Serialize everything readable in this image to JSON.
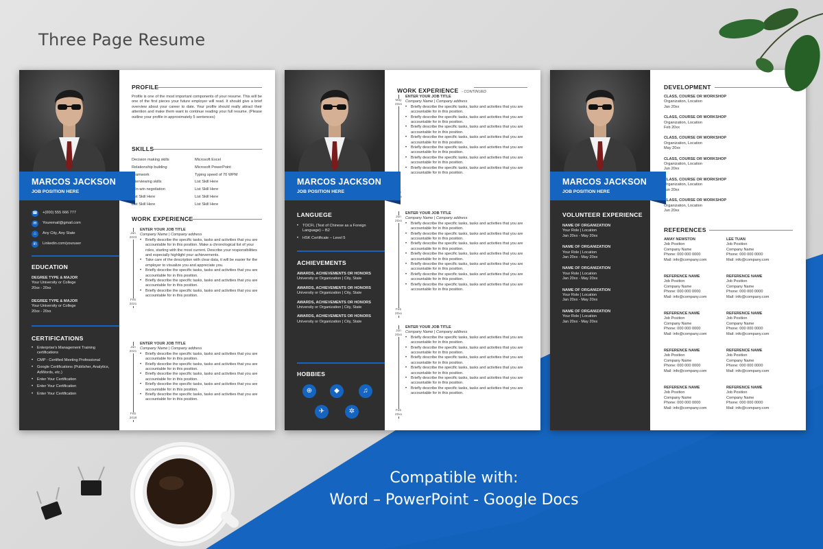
{
  "headline": "Three Page Resume",
  "cta": {
    "line1": "Compatible with:",
    "line2": "Word – PowerPoint - Google Docs"
  },
  "colors": {
    "accent": "#1565c0",
    "sidebar": "#2f2f2f",
    "background": "#dcdcdc"
  },
  "person": {
    "name": "MARCOS JACKSON",
    "job_position": "JOB POSITION HERE"
  },
  "page1": {
    "contacts": [
      {
        "icon": "phone-icon",
        "text": "+(000) 555 666 777"
      },
      {
        "icon": "email-icon",
        "text": "Youremail@gmail.com"
      },
      {
        "icon": "location-icon",
        "text": "Any City, Any State"
      },
      {
        "icon": "linkedin-icon",
        "text": "Linkedin.com/youruser"
      }
    ],
    "education_title": "EDUCATION",
    "education": [
      {
        "degree": "DEGREE TYPE & MAJOR",
        "school": "Your University or College",
        "years": "20xx - 20xx"
      },
      {
        "degree": "DEGREE TYPE & MAJOR",
        "school": "Your University or College",
        "years": "20xx - 20xx"
      }
    ],
    "certifications_title": "CERTIFICATIONS",
    "certifications": [
      "Enterprise's Management Training certifications",
      "CMP - Certified Meeting Professional",
      "Google Certifications (Publisher, Analytics, AdWords, etc.)",
      "Enter Your Certification",
      "Enter Your Certification",
      "Enter Your Certification"
    ],
    "profile_title": "PROFILE",
    "profile_text": "Profile is one of the most important components of your resume. This will be one of the first pieces your future employer will read. It should give a brief overview about your career to date. Your profile should really attract their attention and make them want to continue reading your full resume. (Please outline your profile in approximately 5 sentences)",
    "skills_title": "SKILLS",
    "skills_left": [
      "Decision making skills",
      "Relationship building",
      "Teamwork",
      "Interviewing skills",
      "Win-win negotiation",
      "List Skill Here",
      "List Skill Here"
    ],
    "skills_right": [
      "Microsoft Excel",
      "Microsoft PowerPoint",
      "Typing speed of 70 WPM",
      "List Skill Here",
      "List Skill Here",
      "List Skill Here",
      "List Skill Here"
    ],
    "work_title": "WORK EXPERIENCE",
    "jobs": [
      {
        "title": "ENTER YOUR JOB TITLE",
        "company": "Company Name | Company address",
        "start": "Jan 2023",
        "end": "Feb 2021",
        "bullets": [
          "Briefly describe the specific tasks, tasks and activities that you are accountable for in this position. Make a chronological list of your roles, starting with the most current. Describe your responsibilities and especially highlight your achievements.",
          "Take care of the description with clear data, it will be easier for the employer to visualize you and appreciate you.",
          "Briefly describe the specific tasks, tasks and activities that you are accountable for in this position.",
          "Briefly describe the specific tasks, tasks and activities that you are accountable for in this position.",
          "Briefly describe the specific tasks, tasks and activities that you are accountable for in this position."
        ]
      },
      {
        "title": "ENTER YOUR JOB TITLE",
        "company": "Company Name | Company address",
        "start": "Jan 2021",
        "end": "Feb 2018",
        "bullets": [
          "Briefly describe the specific tasks, tasks and activities that you are accountable for in this position.",
          "Briefly describe the specific tasks, tasks and activities that you are accountable for in this position.",
          "Briefly describe the specific tasks, tasks and activities that you are accountable for in this position.",
          "Briefly describe the specific tasks, tasks and activities that you are accountable for in this position.",
          "Briefly describe the specific tasks, tasks and activities that you are accountable for in this position."
        ]
      }
    ]
  },
  "page2": {
    "language_title": "LANGUEGE",
    "languages": [
      "TOCFL (Test of Chinese as a Foreign Language) – B2",
      "HSK Certificate – Level 5"
    ],
    "achievements_title": "ACHIEVEMENTS",
    "achievements": [
      {
        "title": "AWARDS, ACHIEVEMENTS OR HONORS",
        "org": "University or Organization | City, State"
      },
      {
        "title": "AWARDS, ACHIEVEMENTS OR HONORS",
        "org": "University or Organization | City, State"
      },
      {
        "title": "AWARDS, ACHIEVEMENTS OR HONORS",
        "org": "University or Organization | City, State"
      },
      {
        "title": "AWARDS, ACHIEVEMENTS OR HONORS",
        "org": "University or Organization | City, State"
      }
    ],
    "hobbies_title": "HOBBIES",
    "hobbies": [
      "gamepad-icon",
      "football-icon",
      "music-icon",
      "plane-icon",
      "network-icon"
    ],
    "work_title": "WORK EXPERIENCE",
    "work_subtitle": "- CONTINUED",
    "jobs": [
      {
        "title": "ENTER YOUR JOB TITLE",
        "company": "Company Name | Company address",
        "start": "May 20xx",
        "end": "Mar 20xx"
      },
      {
        "title": "ENTER YOUR JOB TITLE",
        "company": "Company Name | Company address",
        "start": "Jun 20xx",
        "end": "Feb 20xx"
      },
      {
        "title": "ENTER YOUR JOB TITLE",
        "company": "Company Name | Company address",
        "start": "Jun 20xx",
        "end": "Feb 20xx"
      }
    ],
    "bullet_text": "Briefly describe the specific tasks, tasks and activities that you are accountable for in this position."
  },
  "page3": {
    "volunteer_title": "VOLUNTEER EXPERIENCE",
    "volunteer": [
      {
        "org": "NAME OF ORGANIZATION",
        "role": "Your Role | Location",
        "dates": "Jan 20xx - May 20xx"
      },
      {
        "org": "NAME OF ORGANIZATION",
        "role": "Your Role | Location",
        "dates": "Jan 20xx - May 20xx"
      },
      {
        "org": "NAME OF ORGANIZATION",
        "role": "Your Role | Location",
        "dates": "Jan 20xx - May 20xx"
      },
      {
        "org": "NAME OF ORGANIZATION",
        "role": "Your Role | Location",
        "dates": "Jan 20xx - May 20xx"
      },
      {
        "org": "NAME OF ORGANIZATION",
        "role": "Your Role | Location",
        "dates": "Jan 20xx - May 20xx"
      }
    ],
    "development_title": "DEVELOPMENT",
    "development": [
      {
        "title": "CLASS, COURSE OR WORKSHOP",
        "org": "Organization, Location",
        "date": "Jan 20xx"
      },
      {
        "title": "CLASS, COURSE OR WORKSHOP",
        "org": "Organization, Location",
        "date": "Feb 20xx"
      },
      {
        "title": "CLASS, COURSE OR WORKSHOP",
        "org": "Organization, Location",
        "date": "May 20xx"
      },
      {
        "title": "CLASS, COURSE OR WORKSHOP",
        "org": "Organization, Location",
        "date": "Jun 20xx"
      },
      {
        "title": "CLASS, COURSE OR WORKSHOP",
        "org": "Organization, Location",
        "date": "Jun 20xx"
      },
      {
        "title": "CLASS, COURSE OR WORKSHOP",
        "org": "Organization, Location",
        "date": "Jun 20xx"
      }
    ],
    "references_title": "REFERENCES",
    "references": [
      {
        "name": "AMAY NEWSTON",
        "pos": "Job Position",
        "company": "Company Name",
        "phone": "Phone: 000 000 0000",
        "mail": "Mail: info@company.com"
      },
      {
        "name": "LEE TUAN",
        "pos": "Job Position",
        "company": "Company Name",
        "phone": "Phone: 000 000 0000",
        "mail": "Mail: info@company.com"
      },
      {
        "name": "REFERENCE NAME",
        "pos": "Job Position",
        "company": "Company Name",
        "phone": "Phone: 000 000 0000",
        "mail": "Mail: info@company.com"
      },
      {
        "name": "REFERENCE NAME",
        "pos": "Job Position",
        "company": "Company Name",
        "phone": "Phone: 000 000 0000",
        "mail": "Mail: info@company.com"
      },
      {
        "name": "REFERENCE NAME",
        "pos": "Job Position",
        "company": "Company Name",
        "phone": "Phone: 000 000 0000",
        "mail": "Mail: info@company.com"
      },
      {
        "name": "REFERENCE NAME",
        "pos": "Job Position",
        "company": "Company Name",
        "phone": "Phone: 000 000 0000",
        "mail": "Mail: info@company.com"
      },
      {
        "name": "REFERENCE NAME",
        "pos": "Job Position",
        "company": "Company Name",
        "phone": "Phone: 000 000 0000",
        "mail": "Mail: info@company.com"
      },
      {
        "name": "REFERENCE NAME",
        "pos": "Job Position",
        "company": "Company Name",
        "phone": "Phone: 000 000 0000",
        "mail": "Mail: info@company.com"
      },
      {
        "name": "REFERENCE NAME",
        "pos": "Job Position",
        "company": "Company Name",
        "phone": "Phone: 000 000 0000",
        "mail": "Mail: info@company.com"
      },
      {
        "name": "REFERENCE NAME",
        "pos": "Job Position",
        "company": "Company Name",
        "phone": "Phone: 000 000 0000",
        "mail": "Mail: info@company.com"
      }
    ]
  }
}
